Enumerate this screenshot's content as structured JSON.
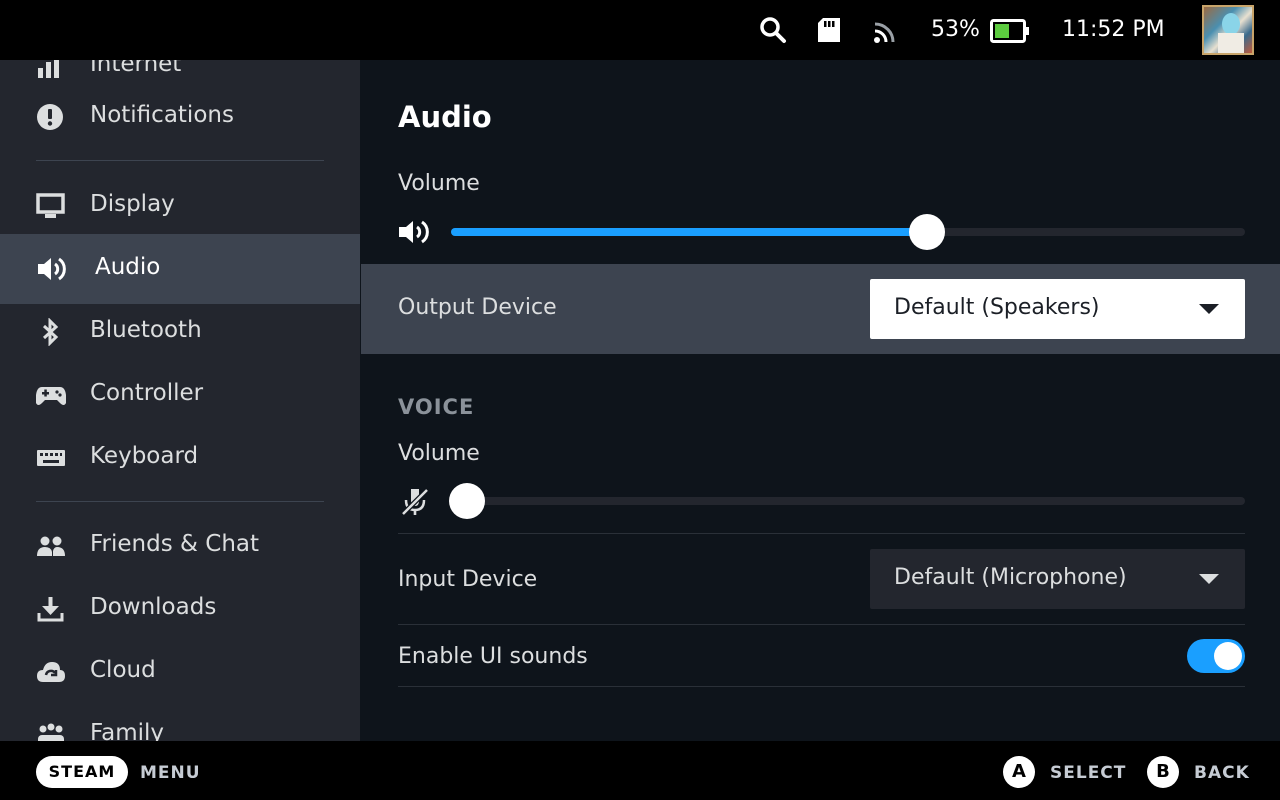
{
  "status_bar": {
    "battery_percent": "53%",
    "battery_level": 0.53,
    "time": "11:52 PM",
    "icons": [
      "search-icon",
      "sd-card-icon",
      "wifi-icon",
      "battery-icon"
    ]
  },
  "sidebar": {
    "items": [
      {
        "label": "Internet",
        "icon": "wifi-icon"
      },
      {
        "label": "Notifications",
        "icon": "alert-icon"
      },
      {
        "label": "Display",
        "icon": "monitor-icon"
      },
      {
        "label": "Audio",
        "icon": "speaker-icon",
        "active": true
      },
      {
        "label": "Bluetooth",
        "icon": "bluetooth-icon"
      },
      {
        "label": "Controller",
        "icon": "gamepad-icon"
      },
      {
        "label": "Keyboard",
        "icon": "keyboard-icon"
      },
      {
        "label": "Friends & Chat",
        "icon": "friends-icon"
      },
      {
        "label": "Downloads",
        "icon": "download-icon"
      },
      {
        "label": "Cloud",
        "icon": "cloud-icon"
      },
      {
        "label": "Family",
        "icon": "family-icon"
      }
    ]
  },
  "main": {
    "title": "Audio",
    "volume": {
      "label": "Volume",
      "value": 0.6
    },
    "output_device": {
      "label": "Output Device",
      "value": "Default (Speakers)"
    },
    "voice": {
      "section_title": "VOICE",
      "volume_label": "Volume",
      "volume_value": 0.02,
      "input_device": {
        "label": "Input Device",
        "value": "Default (Microphone)"
      }
    },
    "ui_sounds": {
      "label": "Enable UI sounds",
      "enabled": true
    }
  },
  "bottom_bar": {
    "steam_label": "STEAM",
    "menu_label": "MENU",
    "a_button": "A",
    "select_label": "SELECT",
    "b_button": "B",
    "back_label": "BACK"
  },
  "colors": {
    "accent": "#1a9fff",
    "sidebar_bg": "#23262e",
    "active_bg": "#3d4450",
    "content_bg": "#0e141b"
  }
}
